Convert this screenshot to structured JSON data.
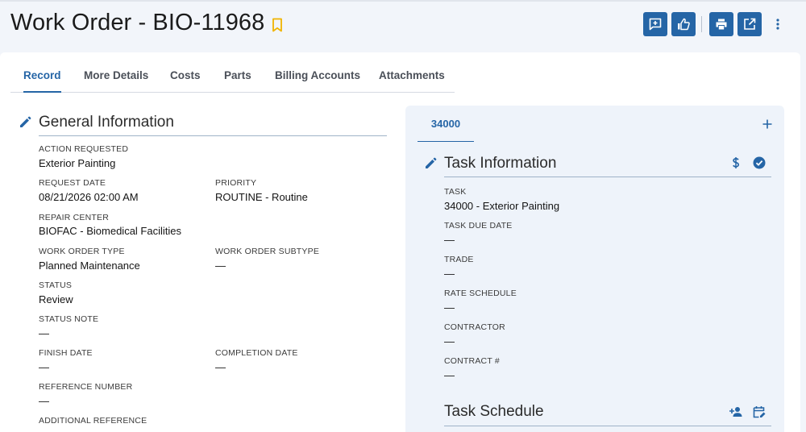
{
  "header": {
    "title": "Work Order - BIO-11968",
    "actions": [
      "add-comment",
      "approve",
      "print",
      "open-external",
      "more"
    ]
  },
  "tabs": [
    {
      "label": "Record",
      "active": true
    },
    {
      "label": "More Details"
    },
    {
      "label": "Costs"
    },
    {
      "label": "Parts"
    },
    {
      "label": "Billing Accounts"
    },
    {
      "label": "Attachments"
    }
  ],
  "general": {
    "title": "General Information",
    "fields": {
      "action_requested": {
        "label": "ACTION REQUESTED",
        "value": "Exterior Painting"
      },
      "request_date": {
        "label": "REQUEST DATE",
        "value": "08/21/2026 02:00 AM"
      },
      "priority": {
        "label": "PRIORITY",
        "value": "ROUTINE - Routine"
      },
      "repair_center": {
        "label": "REPAIR CENTER",
        "value": "BIOFAC - Biomedical Facilities"
      },
      "wo_type": {
        "label": "WORK ORDER TYPE",
        "value": "Planned Maintenance"
      },
      "wo_subtype": {
        "label": "WORK ORDER SUBTYPE",
        "value": "—"
      },
      "status": {
        "label": "STATUS",
        "value": "Review"
      },
      "status_note": {
        "label": "STATUS NOTE",
        "value": "—"
      },
      "finish_date": {
        "label": "FINISH DATE",
        "value": "—"
      },
      "completion_date": {
        "label": "COMPLETION DATE",
        "value": "—"
      },
      "reference_number": {
        "label": "REFERENCE NUMBER",
        "value": "—"
      },
      "additional_reference": {
        "label": "ADDITIONAL REFERENCE",
        "value": ""
      }
    }
  },
  "task_panel": {
    "tab_label": "34000",
    "info_title": "Task Information",
    "fields": {
      "task": {
        "label": "TASK",
        "value": "34000 - Exterior Painting"
      },
      "task_due_date": {
        "label": "TASK DUE DATE",
        "value": "—"
      },
      "trade": {
        "label": "TRADE",
        "value": "—"
      },
      "rate_schedule": {
        "label": "RATE SCHEDULE",
        "value": "—"
      },
      "contractor": {
        "label": "CONTRACTOR",
        "value": "—"
      },
      "contract_no": {
        "label": "CONTRACT #",
        "value": "—"
      }
    },
    "schedule_title": "Task Schedule"
  },
  "colors": {
    "accent": "#2565a6",
    "bookmark": "#f0b400",
    "panel_bg": "#eef3fa"
  },
  "icons": [
    "bookmark-icon",
    "comment-add-icon",
    "thumbs-up-icon",
    "print-icon",
    "open-in-new-icon",
    "more-vert-icon",
    "pencil-icon",
    "plus-icon",
    "dollar-icon",
    "check-circle-icon",
    "person-add-icon",
    "calendar-edit-icon"
  ]
}
